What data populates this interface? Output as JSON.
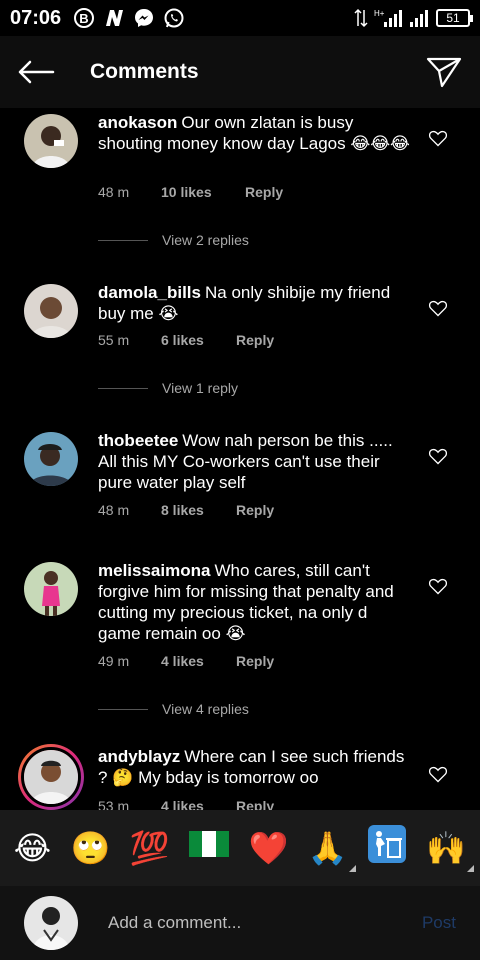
{
  "status_bar": {
    "time": "07:06",
    "battery": "51",
    "network": "H+"
  },
  "header": {
    "title": "Comments"
  },
  "comments": [
    {
      "username": "anokason",
      "text": "Our own zlatan is busy shouting money know day Lagos 😂😂😂",
      "time": "48 m",
      "likes": "10 likes",
      "reply_label": "Reply",
      "view_replies": "View 2 replies",
      "avatar_icon": "profile-photo"
    },
    {
      "username": "damola_bills",
      "text": "Na only shibije my friend buy me 😭",
      "time": "55 m",
      "likes": "6 likes",
      "reply_label": "Reply",
      "view_replies": "View 1 reply",
      "avatar_icon": "profile-photo"
    },
    {
      "username": "thobeetee",
      "text": "Wow nah person be this ..... All this MY Co-workers can't use their pure water play self",
      "time": "48 m",
      "likes": "8 likes",
      "reply_label": "Reply",
      "avatar_icon": "profile-photo"
    },
    {
      "username": "melissaimona",
      "text": "Who cares, still can't forgive him for missing that penalty and cutting my precious ticket, na only d game remain oo 😭",
      "time": "49 m",
      "likes": "4 likes",
      "reply_label": "Reply",
      "view_replies": "View 4 replies",
      "avatar_icon": "profile-photo"
    },
    {
      "username": "andyblayz",
      "text": "Where can I see such friends ? 🤔 My bday is tomorrow oo",
      "time": "53 m",
      "likes": "4 likes",
      "reply_label": "Reply",
      "avatar_icon": "profile-photo-story-ring"
    }
  ],
  "emoji_bar": [
    {
      "glyph": "😂",
      "name": "face-with-tears-of-joy",
      "variants": false
    },
    {
      "glyph": "🙄",
      "name": "face-with-rolling-eyes",
      "variants": false
    },
    {
      "glyph": "💯",
      "name": "hundred-points",
      "variants": false
    },
    {
      "glyph": "🇳🇬",
      "name": "flag-nigeria",
      "variants": false
    },
    {
      "glyph": "❤️",
      "name": "red-heart",
      "variants": false
    },
    {
      "glyph": "🙏",
      "name": "folded-hands",
      "variants": true
    },
    {
      "glyph": "🚮",
      "name": "litter-in-bin",
      "variants": false
    },
    {
      "glyph": "🙌",
      "name": "raising-hands",
      "variants": true
    }
  ],
  "composer": {
    "placeholder": "Add a comment...",
    "post_label": "Post"
  },
  "colors": {
    "background": "#000000",
    "header_bg": "#0e0e0e",
    "secondary_text": "#a8a8a8",
    "post_disabled": "#1e3a66"
  }
}
